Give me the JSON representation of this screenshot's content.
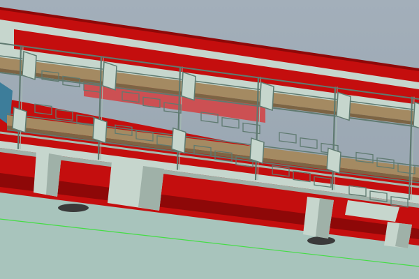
{
  "viewport": {
    "background_top": "#a3afba",
    "background_bottom": "#95a2ad",
    "ground_color": "#a8c4bc",
    "axis_line_color": "#44dd44"
  },
  "model": {
    "hull_red": "#c40e0e",
    "hull_dark_red": "#8e0808",
    "hull_light_red": "#e02a2a",
    "panel_color": "#c6d6cd",
    "panel_shadow": "#9fb1a8",
    "frame_color": "#5f7a70",
    "frame_light": "#a5bcb1",
    "seat_wood": "#a48a62",
    "seat_wood_dark": "#7c6444",
    "accent_blue": "#3d7d9a",
    "base_dark": "#3a3a3a"
  }
}
